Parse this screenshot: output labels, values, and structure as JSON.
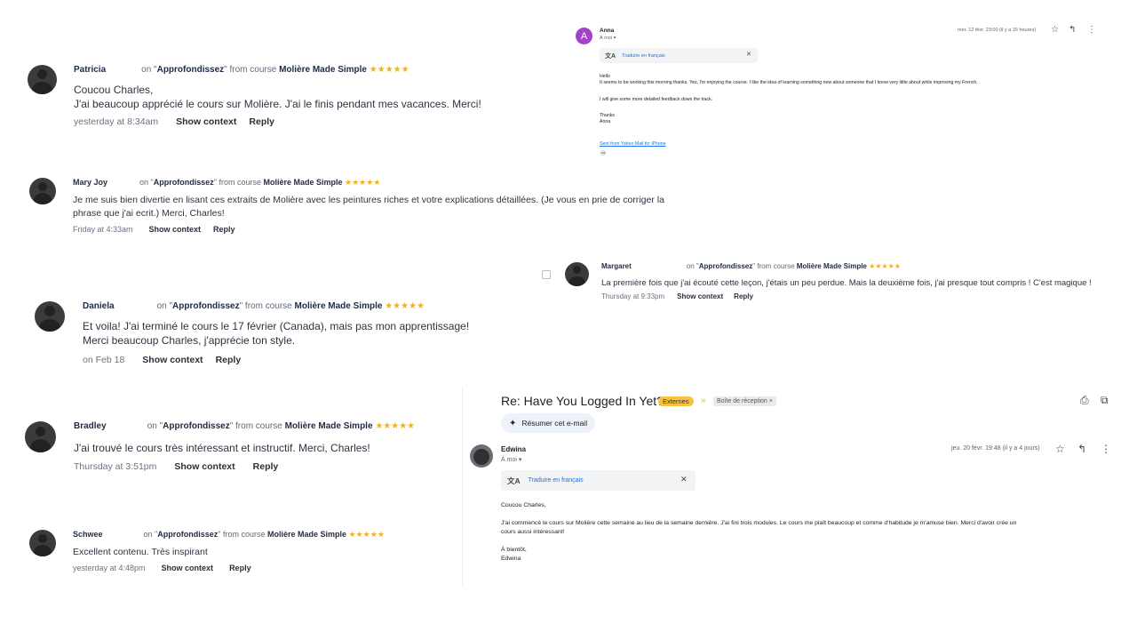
{
  "reviews": [
    {
      "author": "Patricia",
      "on_text": "on \"",
      "module": "Approfondissez",
      "from_text": "\" from course",
      "course": "Molière Made Simple",
      "stars": "★★★★★",
      "lines": [
        "Coucou Charles,",
        "J'ai beaucoup apprécié le cours sur Molière. J'ai le finis pendant mes vacances. Merci!"
      ],
      "time": "yesterday at 8:34am",
      "show_context": "Show context",
      "reply": "Reply"
    },
    {
      "author": "Mary Joy",
      "on_text": "on \"",
      "module": "Approfondissez",
      "from_text": "\" from course",
      "course": "Molière Made Simple",
      "stars": "★★★★★",
      "lines": [
        "Je me suis bien divertie en lisant ces extraits de Molière avec les peintures riches et votre explications détaillées. (Je vous en prie de corriger la",
        "phrase que j'ai ecrit.) Merci, Charles!"
      ],
      "time": "Friday at 4:33am",
      "show_context": "Show context",
      "reply": "Reply"
    },
    {
      "author": "Margaret",
      "on_text": "on \"",
      "module": "Approfondissez",
      "from_text": "\" from course",
      "course": "Molière Made Simple",
      "stars": "★★★★★",
      "lines": [
        "La première fois que j'ai écouté cette leçon, j'étais un peu perdue. Mais la deuxième fois, j'ai presque tout compris ! C'est magique !"
      ],
      "time": "Thursday at 9:33pm",
      "show_context": "Show context",
      "reply": "Reply"
    },
    {
      "author": "Daniela",
      "on_text": "on \"",
      "module": "Approfondissez",
      "from_text": "\" from course",
      "course": "Molière Made Simple",
      "stars": "★★★★★",
      "lines": [
        "Et voila! J'ai terminé le cours le 17 février (Canada), mais pas mon apprentissage!",
        "Merci beaucoup Charles, j'apprécie ton style."
      ],
      "time": "on Feb 18",
      "show_context": "Show context",
      "reply": "Reply"
    },
    {
      "author": "Bradley",
      "on_text": "on \"",
      "module": "Approfondissez",
      "from_text": "\" from course",
      "course": "Molière Made Simple",
      "stars": "★★★★★",
      "lines": [
        "J'ai trouvé le cours très intéressant et instructif. Merci, Charles!"
      ],
      "time": "Thursday at 3:51pm",
      "show_context": "Show context",
      "reply": "Reply"
    },
    {
      "author": "Schwee",
      "on_text": "on \"",
      "module": "Approfondissez",
      "from_text": "\" from course",
      "course": "Molière Made Simple",
      "stars": "★★★★★",
      "lines": [
        "Excellent contenu. Très inspirant"
      ],
      "time": "yesterday at 4:48pm",
      "show_context": "Show context",
      "reply": "Reply"
    }
  ],
  "email_anna": {
    "avatar_letter": "A",
    "avatar_color": "#a142c9",
    "sender": "Anna",
    "recipient": "À moi ▾",
    "date": "mer. 12 févr. 23:00 (il y a 15 heures)",
    "translate_label": "Traduire en français",
    "close": "✕",
    "body": [
      "Hello",
      "It seems to be working this morning thanks. Yes, I'm enjoying the course. I like the idea of learning something new about someone that I know very little about while improving my French.",
      "",
      "I will give some more detailed feedback down the track.",
      "",
      "Thanks",
      "Anna"
    ],
    "signature_link": "Sent from Yahoo Mail for iPhone",
    "ellipsis": "•••"
  },
  "email_edwina": {
    "subject": "Re: Have You Logged In Yet?",
    "label_externes": "Externes",
    "label_inbox": "Boîte de réception ×",
    "summarize": "Résumer cet e-mail",
    "sender": "Edwina",
    "recipient": "À moi ▾",
    "date": "jeu. 20 févr. 19:48 (il y a 4 jours)",
    "translate_label": "Traduire en français",
    "close": "✕",
    "body": [
      "Coucou Charles,",
      "",
      "J'ai commencé le cours sur Molière cette semaine au lieu de la semaine dernière. J'ai fini trois modules. Le cours me plaît beaucoup et comme d'habitude je m'amuse bien. Merci d'avoir crée un",
      "cours aussi intéressant!",
      "",
      "À bientôt,",
      "Edwina"
    ]
  },
  "colors": {
    "star": "#f2b01e",
    "link_blue": "#1a73e8",
    "externes_chip": "#f7c23f",
    "avatar_dark": "#3b3b3b"
  },
  "icons": {
    "star": "star-icon",
    "reply": "reply-icon",
    "more": "more-vert-icon",
    "print": "print-icon",
    "open_new": "open-in-new-icon",
    "translate": "translate-icon",
    "sparkle": "sparkle-icon",
    "important": "important-marker-icon"
  }
}
